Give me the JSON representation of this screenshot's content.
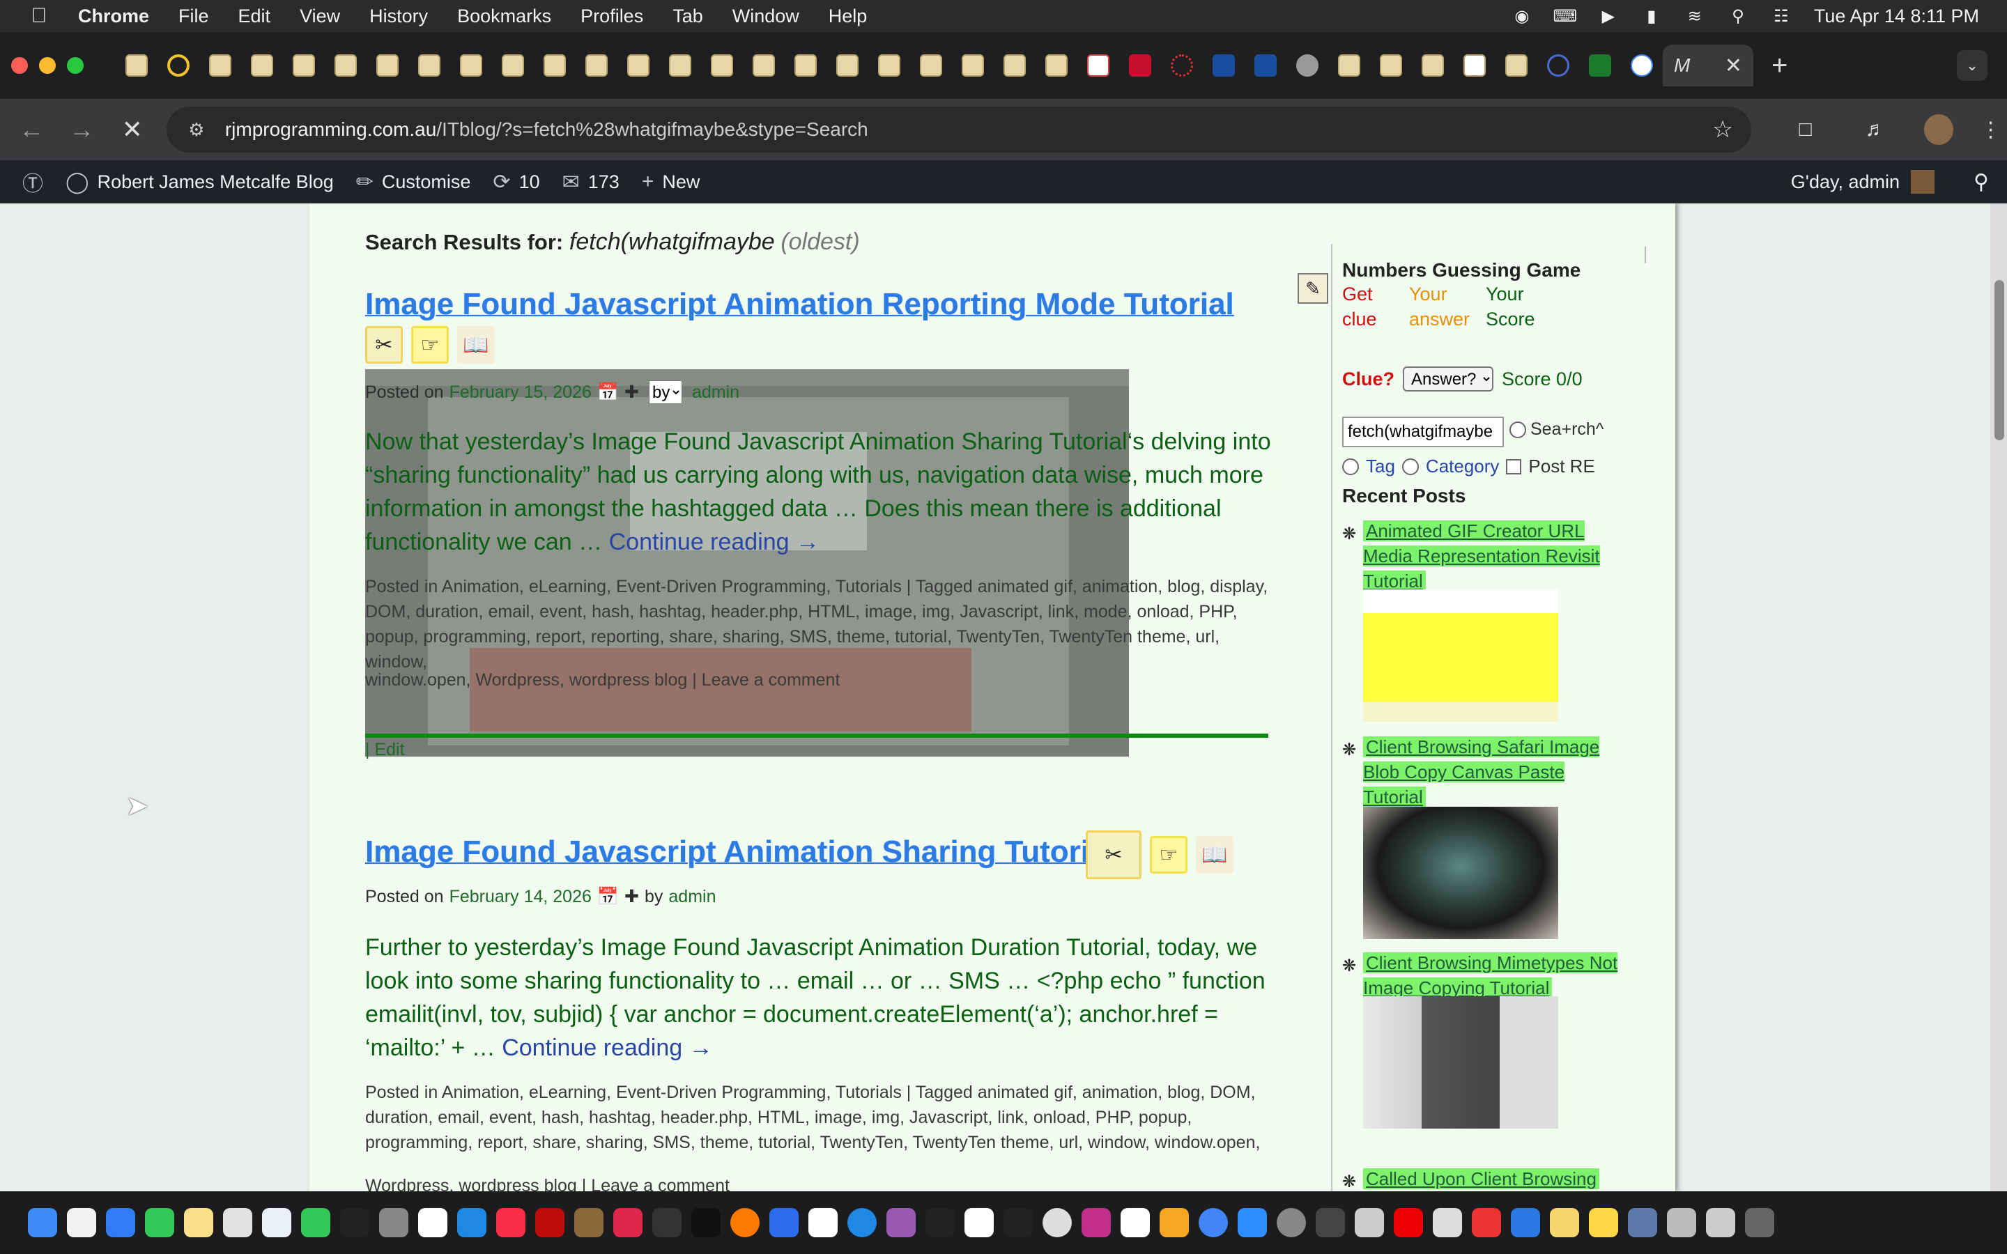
{
  "menubar": {
    "app": "Chrome",
    "items": [
      "File",
      "Edit",
      "View",
      "History",
      "Bookmarks",
      "Profiles",
      "Tab",
      "Window",
      "Help"
    ],
    "datetime": "Tue Apr 14  8:11 PM"
  },
  "browser": {
    "url_host": "rjmprogramming.com.au",
    "url_path": "/ITblog/?s=fetch%28whatgifmaybe&stype=Search",
    "active_tab_label": "M"
  },
  "adminbar": {
    "site": "Robert James Metcalfe Blog",
    "customise": "Customise",
    "updates": "10",
    "comments": "173",
    "new": "New",
    "greeting": "G'day, admin"
  },
  "search": {
    "label": "Search Results for:",
    "query": "fetch(whatgifmaybe",
    "suffix": "(oldest)"
  },
  "posts": [
    {
      "title": "Image Found Javascript Animation Reporting Mode Tutorial",
      "posted_on": "Posted on",
      "date": "February 15, 2026",
      "by_select": "by",
      "author": "admin",
      "excerpt": "Now that yesterday’s Image Found Javascript Animation Sharing Tutorial‘s delving into “sharing functionality” had us carrying along with us, navigation data wise, much more information in amongst the hashtagged data … Does this mean there is additional functionality we can … ",
      "more": "Continue reading →",
      "cats_line": "Posted in Animation, eLearning, Event-Driven Programming, Tutorials | Tagged animated gif, animation, blog, display, DOM, duration, email, event, hash, hashtag, header.php, HTML, image, img, Javascript, link, mode, onload, PHP, popup, programming, report, reporting, share, sharing, SMS, theme, tutorial, TwentyTen, TwentyTen theme, url, window,",
      "cats_line2": "window.open, Wordpress, wordpress blog | Leave a comment",
      "edit": "| Edit"
    },
    {
      "title": "Image Found Javascript Animation Sharing Tutorial",
      "posted_on": "Posted on",
      "date": "February 14, 2026",
      "by": "by",
      "author": "admin",
      "excerpt": "Further to yesterday’s Image Found Javascript Animation Duration Tutorial, today, we look into some sharing functionality to … email … or … SMS … <?php echo ” function emailit(invl, tov, subjid) { var anchor = document.createElement(‘a’); anchor.href = ‘mailto:’ + … ",
      "more": "Continue reading →",
      "cats_line": "Posted in Animation, eLearning, Event-Driven Programming, Tutorials | Tagged animated gif, animation, blog, DOM, duration, email, event, hash, hashtag, header.php, HTML, image, img, Javascript, link, onload, PHP, popup, programming, report, share, sharing, SMS, theme, tutorial, TwentyTen, TwentyTen theme, url, window, window.open,",
      "cats_line2": "Wordpress, wordpress blog | Leave a comment"
    }
  ],
  "sidebar": {
    "game_title": "Numbers Guessing Game",
    "col1": [
      "Get",
      "clue"
    ],
    "col2": [
      "Your",
      "answer"
    ],
    "col3": [
      "Your",
      "Score"
    ],
    "clue_label": "Clue?",
    "clue_select": "Answer?",
    "score": "Score 0/0",
    "search_value": "fetch(whatgifmaybe",
    "search_opt": "Sea+rch^",
    "tag": "Tag",
    "category": "Category",
    "post_re": "Post RE",
    "recent_title": "Recent Posts",
    "recent": [
      "Animated GIF Creator URL Media Representation Revisit Tutorial",
      "Client Browsing Safari Image Blob Copy Canvas Paste Tutorial",
      "Client Browsing Mimetypes Not Image Copying Tutorial",
      "Called Upon Client Browsing"
    ]
  },
  "colors": {
    "title_blue": "#2c7be5",
    "excerpt_green": "#0a5f13",
    "highlight_green": "#7df26a",
    "rule_green": "#0c8b10"
  }
}
